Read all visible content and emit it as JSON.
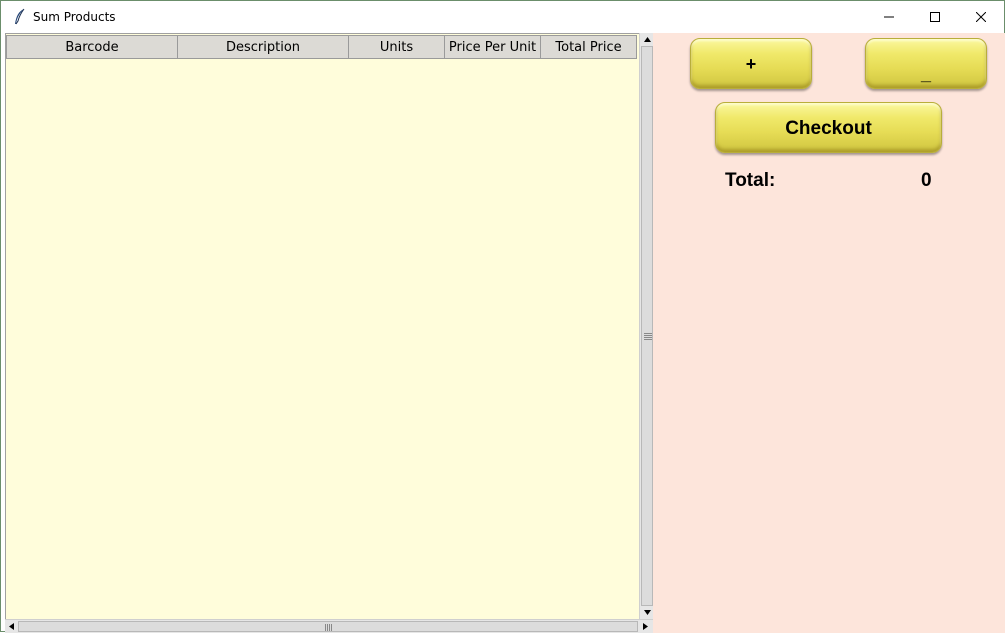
{
  "window": {
    "title": "Sum Products"
  },
  "table": {
    "columns": [
      "Barcode",
      "Description",
      "Units",
      "Price Per Unit",
      "Total Price"
    ],
    "rows": []
  },
  "actions": {
    "plus_label": "+",
    "minus_label": "_",
    "checkout_label": "Checkout"
  },
  "summary": {
    "total_label": "Total:",
    "total_value": "0"
  },
  "colors": {
    "table_background": "#fffddb",
    "panel_background": "#fde5db",
    "button_yellow": "#f0e96a"
  },
  "icons": {
    "app": "feather-icon",
    "minimize": "minimize-icon",
    "maximize": "maximize-icon",
    "close": "close-icon"
  }
}
